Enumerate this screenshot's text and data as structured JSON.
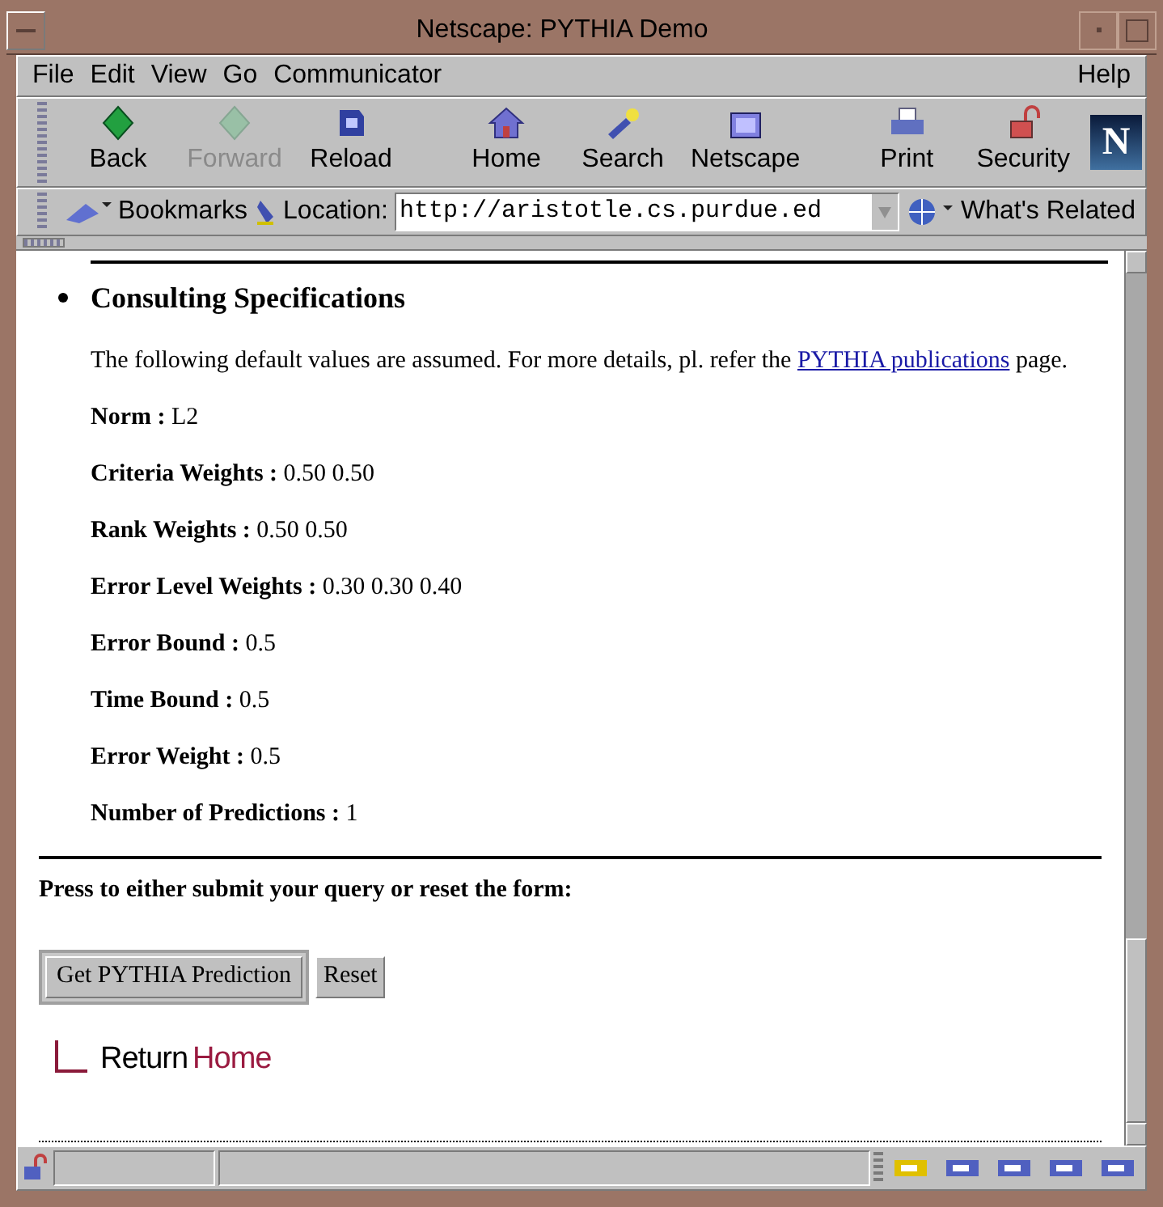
{
  "window": {
    "title": "Netscape: PYTHIA Demo"
  },
  "menu": [
    {
      "label": "File"
    },
    {
      "label": "Edit"
    },
    {
      "label": "View"
    },
    {
      "label": "Go"
    },
    {
      "label": "Communicator"
    }
  ],
  "menu_right": {
    "label": "Help"
  },
  "toolbar": [
    {
      "kind": "back",
      "label": "Back",
      "disabled": false
    },
    {
      "kind": "forward",
      "label": "Forward",
      "disabled": true
    },
    {
      "kind": "reload",
      "label": "Reload",
      "disabled": false
    },
    {
      "kind": "home",
      "label": "Home",
      "disabled": false
    },
    {
      "kind": "search",
      "label": "Search",
      "disabled": false
    },
    {
      "kind": "netscape",
      "label": "Netscape",
      "disabled": false
    },
    {
      "kind": "print",
      "label": "Print",
      "disabled": false
    },
    {
      "kind": "security",
      "label": "Security",
      "disabled": false
    }
  ],
  "logo": {
    "letter": "N"
  },
  "location_bar": {
    "bookmarks": "Bookmarks",
    "location_label": "Location:",
    "url": "http://aristotle.cs.purdue.ed",
    "related": "What's Related"
  },
  "content": {
    "heading": "Consulting Specifications",
    "intro": "The following default values are assumed. For more details, pl. refer the",
    "link": "PYTHIA publications",
    "intro_end": "page.",
    "specs": [
      {
        "label": "Norm :",
        "value": "L2"
      },
      {
        "label": "Criteria Weights :",
        "value": "0.50 0.50"
      },
      {
        "label": "Rank Weights :",
        "value": "0.50 0.50"
      },
      {
        "label": "Error Level Weights :",
        "value": "0.30 0.30 0.40"
      },
      {
        "label": "Error Bound :",
        "value": "0.5"
      },
      {
        "label": "Time Bound :",
        "value": "0.5"
      },
      {
        "label": "Error Weight :",
        "value": "0.5"
      },
      {
        "label": "Number of Predictions :",
        "value": "1"
      }
    ],
    "prompt": "Press to either submit your query or reset the form:",
    "buttons": [
      {
        "label": "Get PYTHIA Prediction",
        "default": true
      },
      {
        "label": "Reset",
        "default": false
      }
    ],
    "return_home": {
      "first": "Return",
      "second": "Home"
    }
  }
}
